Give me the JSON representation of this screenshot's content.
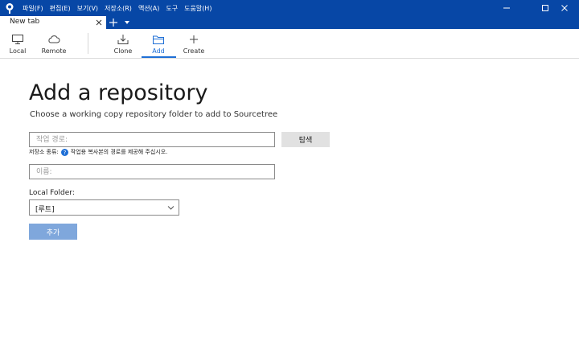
{
  "menu": [
    "파일(F)",
    "편집(E)",
    "보기(V)",
    "저장소(R)",
    "액션(A)",
    "도구",
    "도움말(H)"
  ],
  "tab": {
    "label": "New tab"
  },
  "toolbar": {
    "local": "Local",
    "remote": "Remote",
    "clone": "Clone",
    "add": "Add",
    "create": "Create"
  },
  "page": {
    "title": "Add a repository",
    "subtitle": "Choose a working copy repository folder to add to Sourcetree"
  },
  "form": {
    "path_placeholder": "작업 경로:",
    "browse_label": "탐색",
    "repo_type_label": "저장소 종류:",
    "repo_type_hint": "작업용 복사본의 경로를 제공해 주십시오.",
    "name_placeholder": "이름:",
    "local_folder_label": "Local Folder:",
    "local_folder_value": "[루트]",
    "add_button": "추가"
  },
  "colors": {
    "titlebar": "#0747a6",
    "accent": "#1f6fd6",
    "add_button": "#7fa7dc",
    "browse_button": "#e1e1e1"
  }
}
